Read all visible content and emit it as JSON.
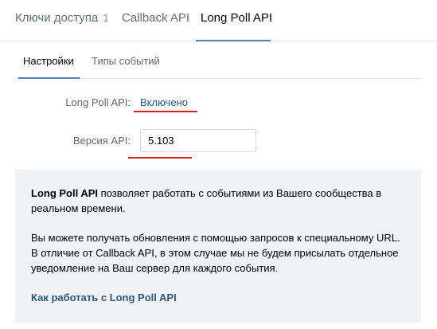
{
  "top_tabs": [
    {
      "label": "Ключи доступа",
      "count": "1"
    },
    {
      "label": "Callback API"
    },
    {
      "label": "Long Poll API"
    }
  ],
  "sub_tabs": [
    {
      "label": "Настройки"
    },
    {
      "label": "Типы событий"
    }
  ],
  "settings": {
    "status_label": "Long Poll API:",
    "status_value": "Включено",
    "version_label": "Версия API:",
    "version_value": "5.103"
  },
  "info": {
    "p1_bold": "Long Poll API",
    "p1_rest": " позволяет работать с событиями из Вашего сообщества в реальном времени.",
    "p2": "Вы можете получать обновления с помощью запросов к специальному URL. В отличие от Callback API, в этом случае мы не будем присылать отдельное уведомление на Ваш сервер для каждого события.",
    "link": "Как работать с Long Poll API"
  },
  "colors": {
    "accent": "#5181b8",
    "link": "#2a5885",
    "annotation": "#e21b1b",
    "info_background": "#f0f2f5"
  }
}
